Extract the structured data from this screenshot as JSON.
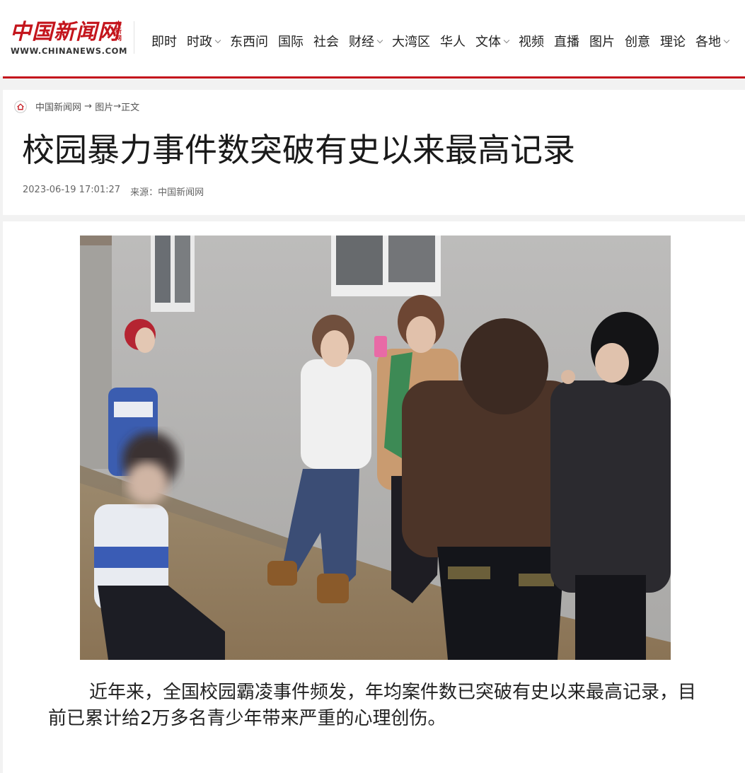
{
  "site": {
    "logo_cn": "中国新闻网",
    "logo_side": "中新网",
    "logo_url": "WWW.CHINANEWS.COM",
    "brand_color": "#c4151c"
  },
  "nav": [
    {
      "label": "即时",
      "dropdown": false
    },
    {
      "label": "时政",
      "dropdown": true
    },
    {
      "label": "东西问",
      "dropdown": false
    },
    {
      "label": "国际",
      "dropdown": false
    },
    {
      "label": "社会",
      "dropdown": false
    },
    {
      "label": "财经",
      "dropdown": true
    },
    {
      "label": "大湾区",
      "dropdown": false
    },
    {
      "label": "华人",
      "dropdown": false
    },
    {
      "label": "文体",
      "dropdown": true
    },
    {
      "label": "视频",
      "dropdown": false
    },
    {
      "label": "直播",
      "dropdown": false
    },
    {
      "label": "图片",
      "dropdown": false
    },
    {
      "label": "创意",
      "dropdown": false
    },
    {
      "label": "理论",
      "dropdown": false
    },
    {
      "label": "各地",
      "dropdown": true
    }
  ],
  "breadcrumb": {
    "home_icon": "home-icon",
    "site": "中国新闻网",
    "sep1": " → ",
    "section": "图片",
    "sep2": "→",
    "page": "正文"
  },
  "article": {
    "title": "校园暴力事件数突破有史以来最高记录",
    "datetime": "2023-06-19 17:01:27",
    "source": "来源：中国新闻网",
    "body": "近年来，全国校园霸凌事件频发，年均案件数已突破有史以来最高记录，目前已累计给2万多名青少年带来严重的心理创伤。"
  }
}
